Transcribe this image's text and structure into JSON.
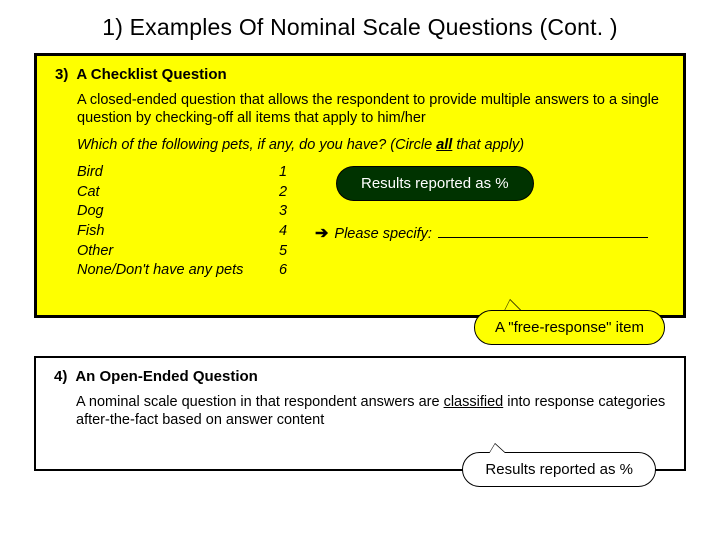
{
  "title": "1) Examples Of Nominal Scale Questions (Cont. )",
  "panel3": {
    "num": "3)",
    "heading": "A Checklist Question",
    "desc_a": "A closed-ended question that allows the respondent to provide multiple answers to a single question by checking-off all items that apply to him/her",
    "prompt_a": "Which of the following pets, if any, do you have? (Circle ",
    "prompt_bold": "all",
    "prompt_b": " that apply)",
    "options": [
      "Bird",
      "Cat",
      "Dog",
      "Fish",
      "Other",
      "None/Don't have any pets"
    ],
    "numbers": [
      "1",
      "2",
      "3",
      "4",
      "5",
      "6"
    ],
    "results_badge": "Results reported as %",
    "specify_arrow": "➔",
    "specify_label": "Please specify:",
    "free_response": "A \"free-response\" item"
  },
  "panel4": {
    "num": "4)",
    "heading": "An Open-Ended Question",
    "desc_pre": "A nominal scale question in that respondent answers are ",
    "desc_ul": "classified",
    "desc_post": " into response categories after-the-fact based on answer content",
    "results_badge": "Results reported as %"
  }
}
